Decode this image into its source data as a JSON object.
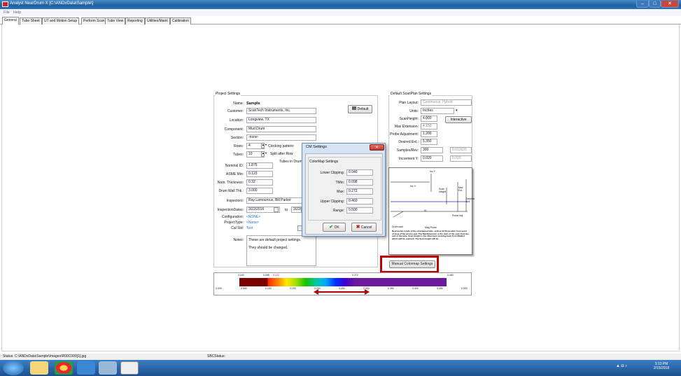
{
  "window": {
    "title": "Analyst NearDrum X [C:\\ANDxData\\Sample\\]",
    "min": "–",
    "max": "□",
    "close": "✕"
  },
  "menu": [
    "File",
    "Help"
  ],
  "tabs": [
    "General",
    "Tube Sheet",
    "UT and Motion Setup",
    "Perform Scan",
    "Tube View",
    "Reporting",
    "Utilities/Maint",
    "Calibration"
  ],
  "project": {
    "group_title": "Project Settings",
    "name_label": "Name:",
    "name": "Sample",
    "customer_label": "Customer:",
    "customer": "ScanTech Instruments, Inc.",
    "location_label": "Location:",
    "location": "Longview, TX",
    "component_label": "Component:",
    "component": "Mud Drum",
    "section_label": "Section:",
    "section": "-none-",
    "rows_label": "Rows:",
    "rows": "4",
    "tubes_label": "Tubes:",
    "tubes": "10",
    "clocking_label": "Clocking pattern:",
    "split_label": "Split after Row",
    "tubes_in_drum_label": "Tubes in Drum",
    "nominal_id_label": "Nominal ID:",
    "nominal_id": "1.875",
    "asme_min_label": "ASME Min:",
    "asme_min": "0.123",
    "nom_thickness_label": "Nom. Thickness:",
    "nom_thickness": "0.32",
    "drum_wall_label": "Drum Wall Thk.:",
    "drum_wall": "3.000",
    "inspectors_label": "Inspectors:",
    "inspectors": "Ray Lamouroux, Bill Parker",
    "dates_label": "InspectionDates:",
    "date_from": "3/22/2016",
    "date_to_label": "to",
    "date_to": "3/22/",
    "configuration_label": "Configuration:",
    "configuration": "<NONE>",
    "project_type_label": "ProjectType:",
    "project_type": "<None>",
    "cal_std_label": "Cal Std:",
    "cal_std": "Test",
    "notes_label": "Notes:",
    "notes_line1": "These are default project settings.",
    "notes_line2": "They should be changed.",
    "default_button": "Default"
  },
  "scanplan": {
    "group_title": "Default ScanPlan Settings",
    "plan_layout_label": "Plan Layout:",
    "plan_layout": "Continuous, Hybrid",
    "units_label": "Units:",
    "units": "Inches",
    "scan_height_label": "ScanHeight:",
    "scan_height": "4.000",
    "max_extension_label": "Max Extension:",
    "max_extension": "4.150",
    "probe_adjust_label": "Probe Adjustment:",
    "probe_adjust": "1.200",
    "desired_ext_label": "Desired Ext.:",
    "desired_ext": "5.350",
    "samples_label": "Samples/Rev:",
    "samples": "300",
    "samples_calc": "0.013635",
    "increment_label": "Increment Y:",
    "increment": "0.020",
    "increment_calc": "0.020",
    "interactive_button": "Interactive",
    "manual_button": "Manual Colormap Settings",
    "diagram_labels": {
      "incy": "Inc Y",
      "incx": "Inc X",
      "scan_height": "Scan Height",
      "max_ext": "Max Ext.",
      "desired_ext": "Desired Ext.",
      "probe_adj": "Probe Adj",
      "id": "ID",
      "drum_wall": "Drum wall",
      "mag_probe": "Mag Probe"
    },
    "diagram_note": "Represents inside of the unwrapped tube, split at 12:00 position from point of view of the access end. The MaxExtension is the start of the scan from the end of the tube. Scan Height is the dimension working back from MaxExt which will be scanned. The Scan height will be"
  },
  "colormap": {
    "top_ticks": [
      "0.040",
      "0.098",
      "0.122",
      "0.272",
      "0.460"
    ],
    "bottom_ticks": [
      "0.000",
      "0.050",
      "0.100",
      "0.150",
      "0.200",
      "0.250",
      "0.300",
      "0.350",
      "0.400",
      "0.450",
      "0.500"
    ]
  },
  "dialog": {
    "title": "CM Settings",
    "group_title": "ColorMap Settings",
    "lower_label": "Lower Clipping:",
    "lower": "0.040",
    "tmin_label": "TMin:",
    "tmin": "0.098",
    "max_label": "Max:",
    "max": "0.272",
    "upper_label": "Upper Clipping:",
    "upper": "0.460",
    "range_label": "Range:",
    "range": "0.500",
    "ok": "OK",
    "cancel": "Cancel"
  },
  "status": {
    "file": "Status: C:\\ANDxData\\Sample\\Images\\R00C000[1].jpg",
    "sbc": "SBCStatus:"
  },
  "taskbar": {
    "time": "3:13 PM",
    "date": "2/15/2018"
  },
  "colors": {
    "highlight": "#c00000",
    "link": "#1a6fd0"
  }
}
